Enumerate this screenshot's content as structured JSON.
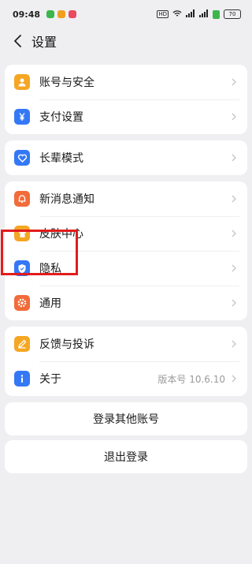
{
  "status_bar": {
    "time": "09:48",
    "hd": "HD",
    "battery": "70"
  },
  "nav": {
    "title": "设置"
  },
  "groups": [
    {
      "items": [
        {
          "label": "账号与安全",
          "icon": "user-icon",
          "color": "#f5a623"
        },
        {
          "label": "支付设置",
          "icon": "yen-icon",
          "color": "#3478f6"
        }
      ]
    },
    {
      "items": [
        {
          "label": "长辈模式",
          "icon": "heart-hands-icon",
          "color": "#3478f6"
        }
      ]
    },
    {
      "items": [
        {
          "label": "新消息通知",
          "icon": "bell-icon",
          "color": "#f26b3a"
        },
        {
          "label": "皮肤中心",
          "icon": "shirt-icon",
          "color": "#f5a623"
        },
        {
          "label": "隐私",
          "icon": "shield-icon",
          "color": "#3478f6"
        },
        {
          "label": "通用",
          "icon": "gear-icon",
          "color": "#f26b3a"
        }
      ]
    },
    {
      "items": [
        {
          "label": "反馈与投诉",
          "icon": "pencil-icon",
          "color": "#f5a623"
        },
        {
          "label": "关于",
          "icon": "info-icon",
          "color": "#3478f6",
          "meta": "版本号 10.6.10"
        }
      ]
    }
  ],
  "buttons": {
    "switch_account": "登录其他账号",
    "logout": "退出登录"
  },
  "highlight_color": "#e21c1c"
}
